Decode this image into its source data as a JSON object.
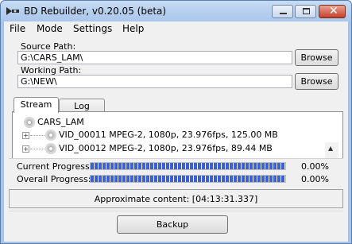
{
  "window": {
    "title": "BD Rebuilder, v0.20.05 (beta)",
    "controls": {
      "minimize": "minimize",
      "maximize": "maximize",
      "close": "✕"
    }
  },
  "menu": [
    "File",
    "Mode",
    "Settings",
    "Help"
  ],
  "source": {
    "label": "Source Path:",
    "value": "G:\\CARS_LAM\\",
    "button": "Browse"
  },
  "working": {
    "label": "Working Path:",
    "value": "G:\\NEW\\",
    "button": "Browse"
  },
  "tabs": [
    {
      "label": "Stream",
      "active": true
    },
    {
      "label": "Log",
      "active": false
    }
  ],
  "tree": {
    "root": "CARS_LAM",
    "items": [
      {
        "expander": "+",
        "label": "VID_00011 MPEG-2, 1080p, 23.976fps, 125.00 MB"
      },
      {
        "expander": "+",
        "label": "VID_00012 MPEG-2, 1080p, 23.976fps, 89.44 MB"
      }
    ]
  },
  "progress": {
    "current": {
      "label": "Current Progress:",
      "value": "0.00%",
      "fill_fraction": 1.0
    },
    "overall": {
      "label": "Overall Progress:",
      "value": "0.00%",
      "fill_fraction": 1.0
    }
  },
  "approx": "Approximate content: [04:13:31.337]",
  "backup_button": "Backup",
  "colors": {
    "progress_fill": "#3c5fd6",
    "titlebar": "#a9c6ea",
    "close_button": "#c4412a"
  },
  "icons": {
    "app": "bd-rebuilder-app-icon",
    "disc": "disc-icon",
    "scroll_up": "scroll-up-arrow-icon"
  }
}
